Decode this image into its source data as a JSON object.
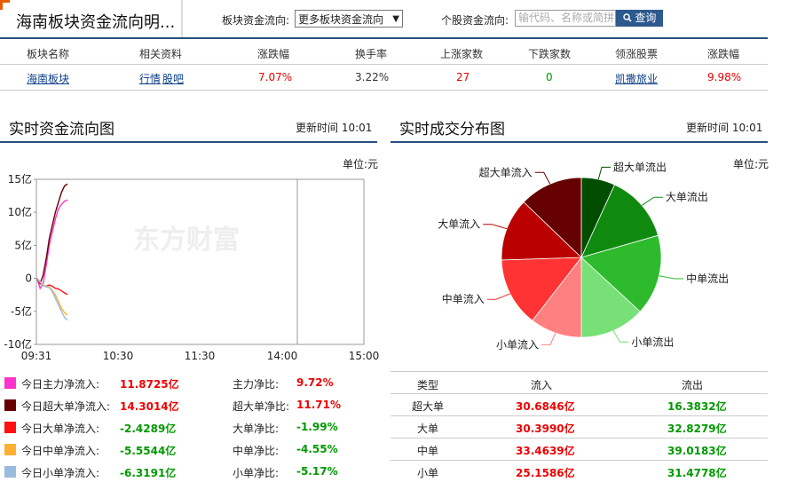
{
  "header": {
    "title": "海南板块资金流向明...",
    "sector_flow_label": "板块资金流向:",
    "sector_select_value": "更多板块资金流向",
    "stock_flow_label": "个股资金流向:",
    "search_placeholder": "输代码、名称或简拼",
    "search_button": "查询"
  },
  "summary_table": {
    "headers": [
      "板块名称",
      "相关资料",
      "涨跌幅",
      "换手率",
      "上涨家数",
      "下跌家数",
      "领涨股票",
      "涨跌幅"
    ],
    "row": {
      "name": "海南板块",
      "links": [
        "行情",
        "股吧"
      ],
      "change": "7.07%",
      "turnover": "3.22%",
      "up_count": "27",
      "down_count": "0",
      "leader": "凯撒旅业",
      "leader_change": "9.98%"
    }
  },
  "flow_chart": {
    "title": "实时资金流向图",
    "update_time": "更新时间 10:01",
    "unit": "单位:元",
    "watermark": "东方财富",
    "chart_data": {
      "type": "line",
      "x_ticks": [
        "09:31",
        "10:30",
        "11:30",
        "14:00",
        "15:00"
      ],
      "y_ticks": [
        "15亿",
        "10亿",
        "5亿",
        "0",
        "-5亿",
        "-10亿"
      ],
      "ylim": [
        -10,
        15
      ],
      "series": [
        {
          "name": "今日主力净流入",
          "color": "#ff33cc",
          "points": [
            [
              0,
              0
            ],
            [
              2,
              -1.5
            ],
            [
              4,
              -0.8
            ],
            [
              6,
              2
            ],
            [
              8,
              5
            ],
            [
              10,
              7
            ],
            [
              12,
              9
            ],
            [
              14,
              10.5
            ],
            [
              16,
              11.2
            ],
            [
              18,
              11.7
            ],
            [
              20,
              11.87
            ]
          ]
        },
        {
          "name": "今日超大单净流入",
          "color": "#660000",
          "points": [
            [
              0,
              0
            ],
            [
              2,
              -0.8
            ],
            [
              4,
              0.5
            ],
            [
              6,
              3
            ],
            [
              8,
              6
            ],
            [
              10,
              8
            ],
            [
              12,
              10
            ],
            [
              14,
              11.5
            ],
            [
              16,
              13
            ],
            [
              18,
              14
            ],
            [
              20,
              14.3
            ]
          ]
        },
        {
          "name": "今日大单净流入",
          "color": "#ff1111",
          "points": [
            [
              0,
              0
            ],
            [
              2,
              -0.7
            ],
            [
              4,
              -1
            ],
            [
              6,
              -1.2
            ],
            [
              8,
              -1
            ],
            [
              10,
              -1.2
            ],
            [
              12,
              -1.5
            ],
            [
              14,
              -1.6
            ],
            [
              16,
              -1.9
            ],
            [
              18,
              -2.2
            ],
            [
              20,
              -2.43
            ]
          ]
        },
        {
          "name": "今日中单净流入",
          "color": "#ffb033",
          "points": [
            [
              0,
              0
            ],
            [
              2,
              -0.5
            ],
            [
              4,
              -1
            ],
            [
              6,
              -1.2
            ],
            [
              8,
              -1.3
            ],
            [
              10,
              -1.8
            ],
            [
              12,
              -2.5
            ],
            [
              14,
              -3.5
            ],
            [
              16,
              -4.5
            ],
            [
              18,
              -5.2
            ],
            [
              20,
              -5.55
            ]
          ]
        },
        {
          "name": "今日小单净流入",
          "color": "#99bbdd",
          "points": [
            [
              0,
              0
            ],
            [
              2,
              -0.6
            ],
            [
              4,
              -1.1
            ],
            [
              6,
              -1.3
            ],
            [
              8,
              -1.4
            ],
            [
              10,
              -2
            ],
            [
              12,
              -3
            ],
            [
              14,
              -4
            ],
            [
              16,
              -5
            ],
            [
              18,
              -5.9
            ],
            [
              20,
              -6.32
            ]
          ]
        }
      ]
    },
    "legend": [
      {
        "color": "#ff33cc",
        "label": "今日主力净流入:",
        "value": "11.8725亿",
        "ratio_label": "主力净比:",
        "ratio": "9.72%",
        "sign": "pos"
      },
      {
        "color": "#660000",
        "label": "今日超大单净流入:",
        "value": "14.3014亿",
        "ratio_label": "超大单净比:",
        "ratio": "11.71%",
        "sign": "pos"
      },
      {
        "color": "#ff1111",
        "label": "今日大单净流入:",
        "value": "-2.4289亿",
        "ratio_label": "大单净比:",
        "ratio": "-1.99%",
        "sign": "neg"
      },
      {
        "color": "#ffb033",
        "label": "今日中单净流入:",
        "value": "-5.5544亿",
        "ratio_label": "中单净比:",
        "ratio": "-4.55%",
        "sign": "neg"
      },
      {
        "color": "#99bbdd",
        "label": "今日小单净流入:",
        "value": "-6.3191亿",
        "ratio_label": "小单净比:",
        "ratio": "-5.17%",
        "sign": "neg"
      }
    ]
  },
  "pie_chart": {
    "title": "实时成交分布图",
    "update_time": "更新时间 10:01",
    "unit": "单位:元",
    "chart_data": {
      "type": "pie",
      "slices": [
        {
          "label": "超大单流出",
          "value": 16.3832,
          "color": "#004d00"
        },
        {
          "label": "大单流出",
          "value": 32.8279,
          "color": "#0f8a0f"
        },
        {
          "label": "中单流出",
          "value": 39.0183,
          "color": "#2dbb2d"
        },
        {
          "label": "小单流出",
          "value": 31.4778,
          "color": "#77e077"
        },
        {
          "label": "小单流入",
          "value": 25.1586,
          "color": "#ff8080"
        },
        {
          "label": "中单流入",
          "value": 33.4639,
          "color": "#ff3333"
        },
        {
          "label": "大单流入",
          "value": 30.399,
          "color": "#bb0000"
        },
        {
          "label": "超大单流入",
          "value": 30.6846,
          "color": "#660000"
        }
      ]
    },
    "table": {
      "headers": [
        "类型",
        "流入",
        "流出"
      ],
      "rows": [
        {
          "type": "超大单",
          "in": "30.6846亿",
          "out": "16.3832亿"
        },
        {
          "type": "大单",
          "in": "30.3990亿",
          "out": "32.8279亿"
        },
        {
          "type": "中单",
          "in": "33.4639亿",
          "out": "39.0183亿"
        },
        {
          "type": "小单",
          "in": "25.1586亿",
          "out": "31.4778亿"
        }
      ]
    }
  }
}
